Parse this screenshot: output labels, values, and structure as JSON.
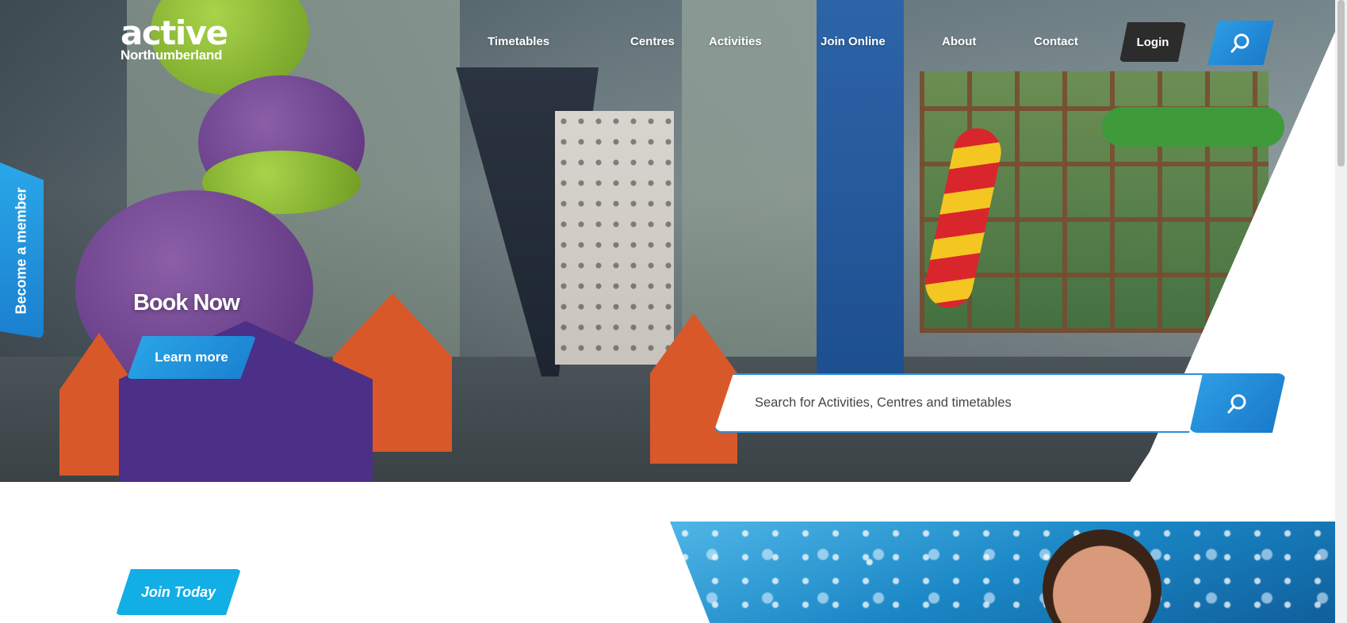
{
  "header": {
    "logo_main": "active",
    "logo_sub": "Northumberland",
    "nav": [
      "Timetables",
      "Centres",
      "Activities",
      "Join Online",
      "About",
      "Contact"
    ],
    "login_label": "Login",
    "search_icon": "search-icon"
  },
  "member_tab": {
    "label": "Become a member"
  },
  "hero": {
    "title": "Book Now",
    "cta_label": "Learn more"
  },
  "search": {
    "placeholder": "Search for Activities, Centres and timetables",
    "icon": "search-icon"
  },
  "section": {
    "cta_label": "Join Today"
  },
  "colors": {
    "accent": "#1a7fcf",
    "accent_light": "#12aee6",
    "login_bg": "#2c2c2c"
  }
}
